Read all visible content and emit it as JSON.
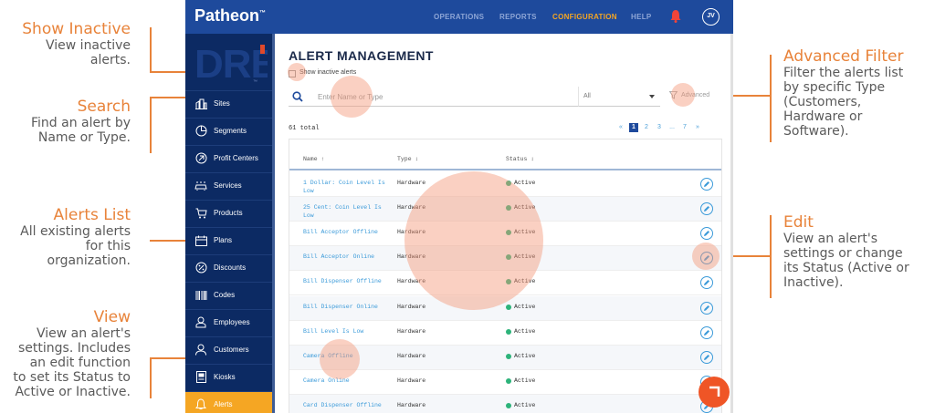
{
  "callouts": {
    "show_inactive": {
      "title": "Show Inactive",
      "desc1": "View inactive",
      "desc2": "alerts."
    },
    "search": {
      "title": "Search",
      "desc1": "Find an alert by",
      "desc2": "Name or Type."
    },
    "alerts_list": {
      "title": "Alerts List",
      "desc1": "All existing alerts",
      "desc2": "for this",
      "desc3": "organization."
    },
    "view": {
      "title": "View",
      "desc1": "View an alert's",
      "desc2": "settings. Includes",
      "desc3": "an edit function",
      "desc4": "to set its Status to",
      "desc5": "Active or Inactive."
    },
    "advanced_filter": {
      "title": "Advanced Filter",
      "desc1": "Filter the alerts list",
      "desc2": "by specific Type",
      "desc3": "(Customers,",
      "desc4": "Hardware or",
      "desc5": "Software)."
    },
    "edit": {
      "title": "Edit",
      "desc1": "View an alert's",
      "desc2": "settings or change",
      "desc3": "its Status (Active or",
      "desc4": "Inactive)."
    }
  },
  "colors": {
    "accent": "#e8833a",
    "topbar": "#1e4a9c",
    "sidebar": "#0c2a63",
    "active_nav": "#f5a623",
    "status_active": "#2db37a",
    "link": "#3a9ad9"
  },
  "app": {
    "logo": "Patheon",
    "logo_mark": "™",
    "nav": [
      "OPERATIONS",
      "REPORTS",
      "CONFIGURATION",
      "HELP"
    ],
    "active_nav": "CONFIGURATION",
    "avatar": "JV",
    "bell_icon": "bell-icon",
    "sidebar_logo": "DRB",
    "sidebar_logo_mark": "™",
    "sidebar": [
      {
        "label": "Sites",
        "icon": "sites-icon"
      },
      {
        "label": "Segments",
        "icon": "pie-chart-icon"
      },
      {
        "label": "Profit Centers",
        "icon": "profit-centers-icon"
      },
      {
        "label": "Services",
        "icon": "car-wash-icon"
      },
      {
        "label": "Products",
        "icon": "cart-icon"
      },
      {
        "label": "Plans",
        "icon": "calendar-icon"
      },
      {
        "label": "Discounts",
        "icon": "discount-icon"
      },
      {
        "label": "Codes",
        "icon": "barcode-icon"
      },
      {
        "label": "Employees",
        "icon": "employee-icon"
      },
      {
        "label": "Customers",
        "icon": "customer-icon"
      },
      {
        "label": "Kiosks",
        "icon": "kiosk-icon"
      },
      {
        "label": "Alerts",
        "icon": "alert-icon"
      }
    ],
    "active_sidebar": "Alerts"
  },
  "page": {
    "title": "ALERT MANAGEMENT",
    "show_inactive_label": "Show inactive alerts",
    "show_inactive_checked": false,
    "search_placeholder": "Enter Name or Type",
    "search_value": "",
    "type_select": "All",
    "advanced_label": "Advanced",
    "total": "61 total",
    "pagination": {
      "prev": "«",
      "pages": [
        "1",
        "2",
        "3",
        "...",
        "7"
      ],
      "current": "1",
      "next": "»"
    },
    "columns": [
      "Name ↑",
      "Type ↕",
      "Status ↕"
    ],
    "rows": [
      {
        "name": "1 Dollar: Coin Level Is Low",
        "type": "Hardware",
        "status": "Active"
      },
      {
        "name": "25 Cent: Coin Level Is Low",
        "type": "Hardware",
        "status": "Active"
      },
      {
        "name": "Bill Acceptor Offline",
        "type": "Hardware",
        "status": "Active"
      },
      {
        "name": "Bill Acceptor Online",
        "type": "Hardware",
        "status": "Active"
      },
      {
        "name": "Bill Dispenser Offline",
        "type": "Hardware",
        "status": "Active"
      },
      {
        "name": "Bill Dispenser Online",
        "type": "Hardware",
        "status": "Active"
      },
      {
        "name": "Bill Level Is Low",
        "type": "Hardware",
        "status": "Active"
      },
      {
        "name": "Camera Offline",
        "type": "Hardware",
        "status": "Active"
      },
      {
        "name": "Camera Online",
        "type": "Hardware",
        "status": "Active"
      },
      {
        "name": "Card Dispenser Offline",
        "type": "Hardware",
        "status": "Active"
      }
    ]
  }
}
